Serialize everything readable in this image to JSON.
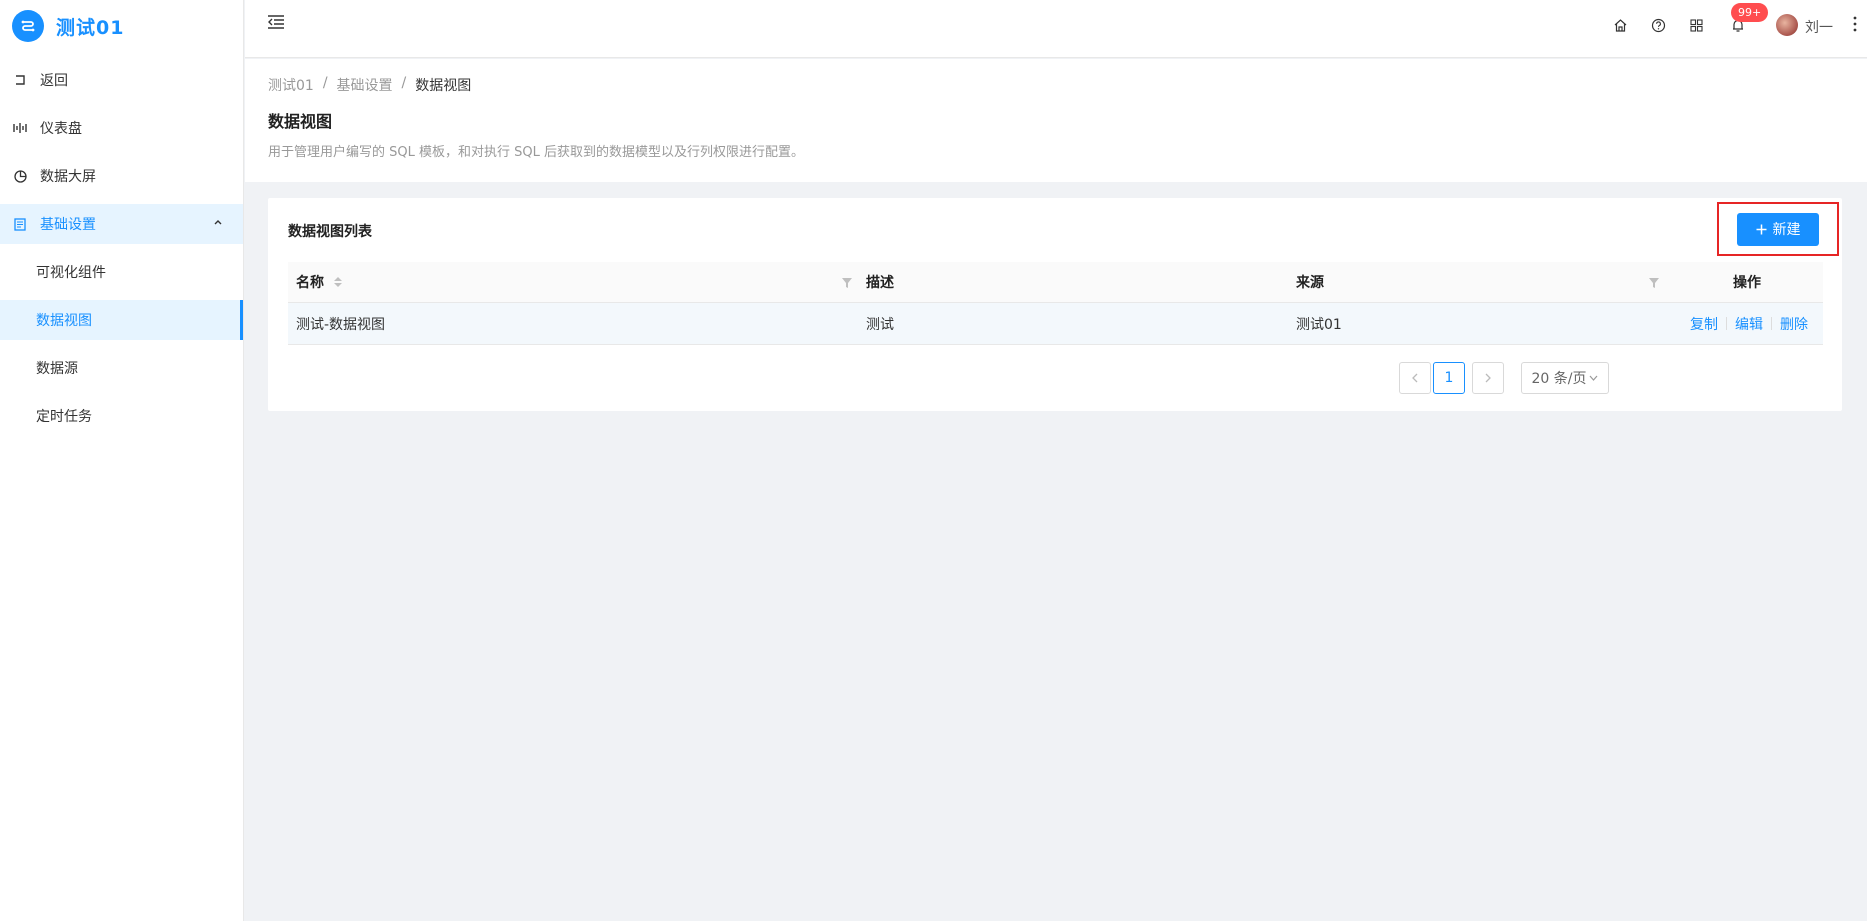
{
  "app": {
    "title": "测试01",
    "accent": "#1890ff"
  },
  "sidebar": {
    "items": [
      {
        "label": "返回",
        "icon": "back-icon"
      },
      {
        "label": "仪表盘",
        "icon": "dashboard-icon"
      },
      {
        "label": "数据大屏",
        "icon": "pie-chart-icon"
      },
      {
        "label": "基础设置",
        "icon": "settings-doc-icon",
        "expanded": true
      }
    ],
    "subitems": [
      {
        "label": "可视化组件"
      },
      {
        "label": "数据视图",
        "active": true
      },
      {
        "label": "数据源"
      },
      {
        "label": "定时任务"
      }
    ]
  },
  "header": {
    "icons": [
      "menu-fold-icon",
      "home-icon",
      "help-icon",
      "apps-icon",
      "bell-icon",
      "more-vertical-icon"
    ],
    "notification_badge": "99+",
    "username": "刘一"
  },
  "breadcrumb": [
    "测试01",
    "基础设置",
    "数据视图"
  ],
  "page": {
    "title": "数据视图",
    "description": "用于管理用户编写的 SQL 模板，和对执行 SQL 后获取到的数据模型以及行列权限进行配置。"
  },
  "card": {
    "title": "数据视图列表",
    "new_button": "新建"
  },
  "table": {
    "columns": [
      "名称",
      "描述",
      "来源",
      "操作"
    ],
    "rows": [
      {
        "name": "测试-数据视图",
        "description": "测试",
        "source": "测试01",
        "actions": [
          "复制",
          "编辑",
          "删除"
        ]
      }
    ]
  },
  "pagination": {
    "current": "1",
    "page_size": "20 条/页"
  }
}
